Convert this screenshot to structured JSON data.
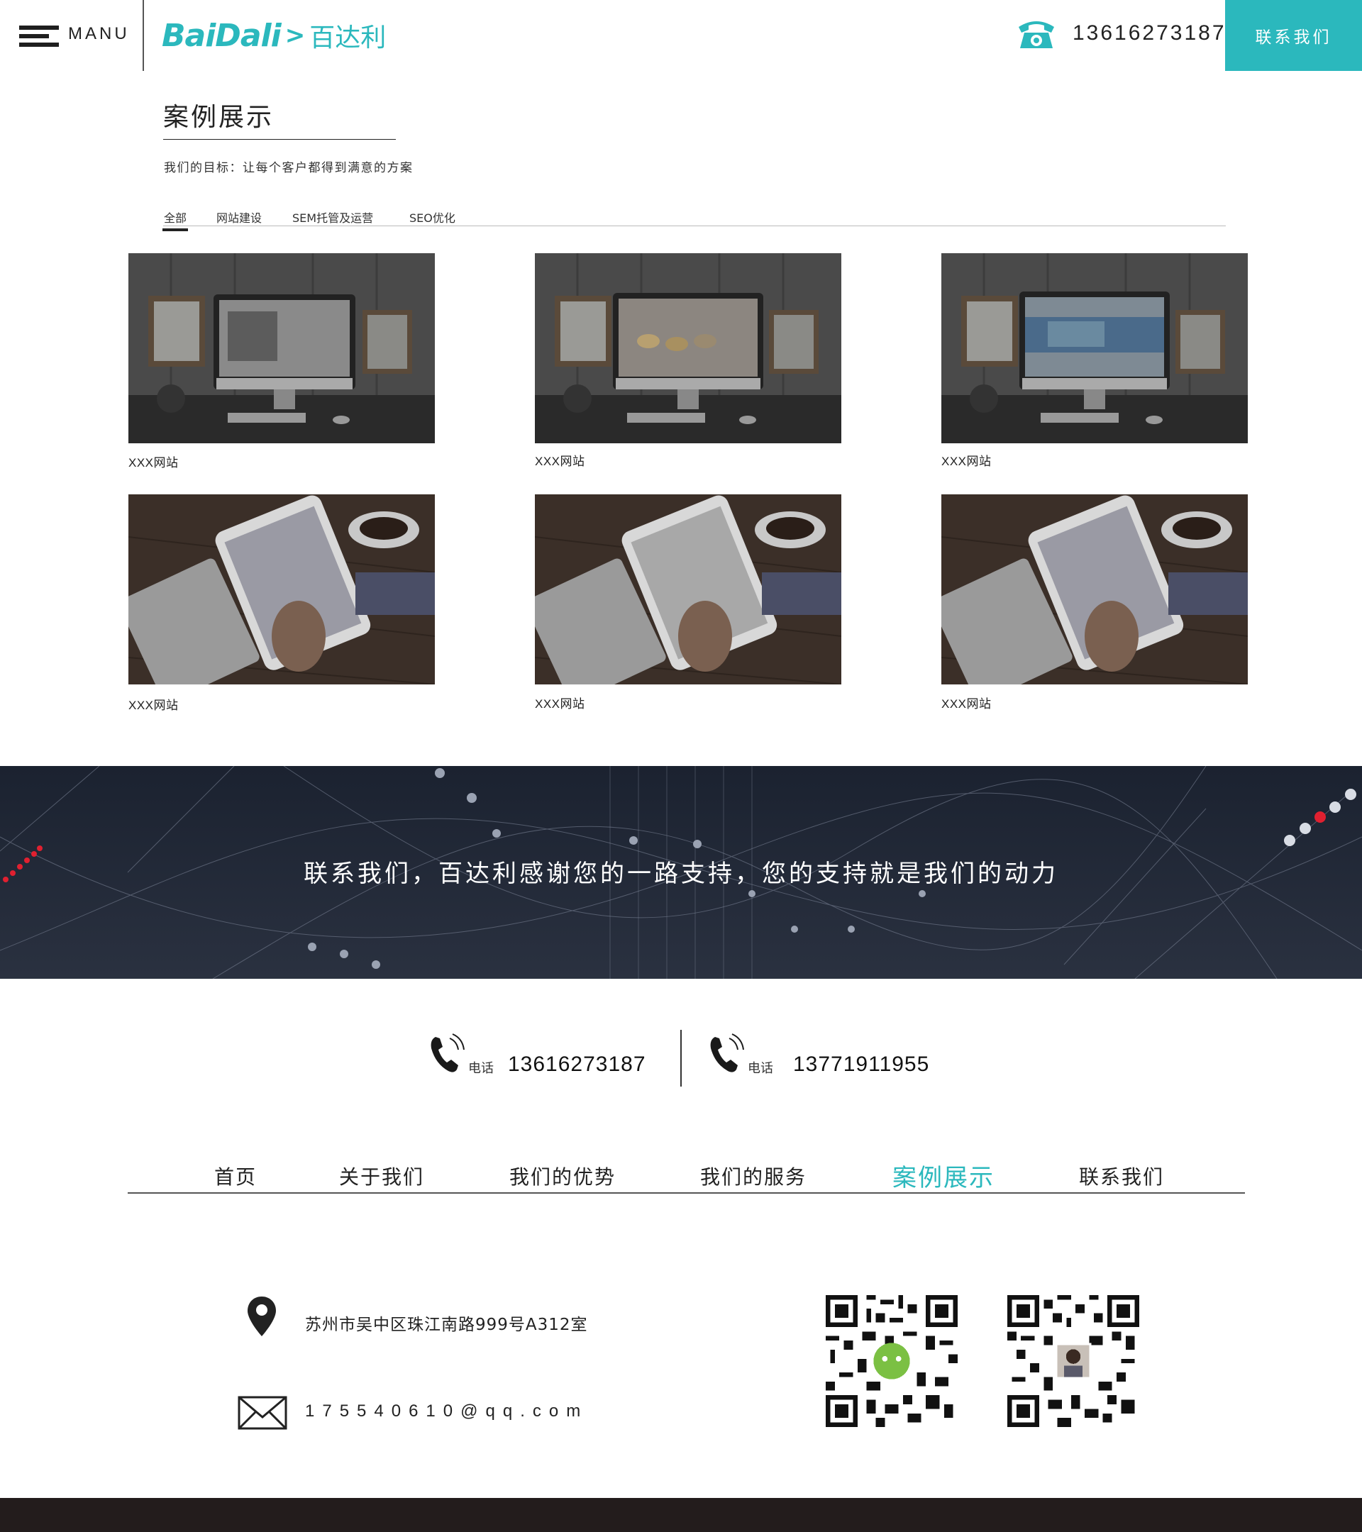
{
  "header": {
    "menu_label": "MANU",
    "logo_en": "BaiDali",
    "logo_arrow": ">",
    "logo_cn": "百达利",
    "phone": "13616273187",
    "contact_button": "联系我们",
    "accent_color": "#2bb8bd"
  },
  "cases": {
    "title": "案例展示",
    "subtitle": "我们的目标：让每个客户都得到满意的方案",
    "tabs": [
      "全部",
      "网站建设",
      "SEM托管及运营",
      "SEO优化"
    ],
    "active_tab": "全部",
    "items": [
      {
        "caption": "XXX网站",
        "image": "desktop-monitor-mockup"
      },
      {
        "caption": "XXX网站",
        "image": "desktop-monitor-mockup"
      },
      {
        "caption": "XXX网站",
        "image": "desktop-monitor-mockup"
      },
      {
        "caption": "XXX网站",
        "image": "tablet-in-hand-mockup"
      },
      {
        "caption": "XXX网站",
        "image": "tablet-in-hand-mockup"
      },
      {
        "caption": "XXX网站",
        "image": "tablet-in-hand-mockup"
      }
    ]
  },
  "banner": {
    "text": "联系我们，百达利感谢您的一路支持，您的支持就是我们的动力"
  },
  "contact": {
    "phones": [
      {
        "label": "电话",
        "number": "13616273187"
      },
      {
        "label": "电话",
        "number": "13771911955"
      }
    ]
  },
  "footer_nav": {
    "items": [
      "首页",
      "关于我们",
      "我们的优势",
      "我们的服务",
      "案例展示",
      "联系我们"
    ],
    "active": "案例展示"
  },
  "footer": {
    "address": "苏州市吴中区珠江南路999号A312室",
    "email": "175540610@qq.com",
    "qr_codes": [
      "wechat-qr-code",
      "personal-qr-code"
    ]
  }
}
